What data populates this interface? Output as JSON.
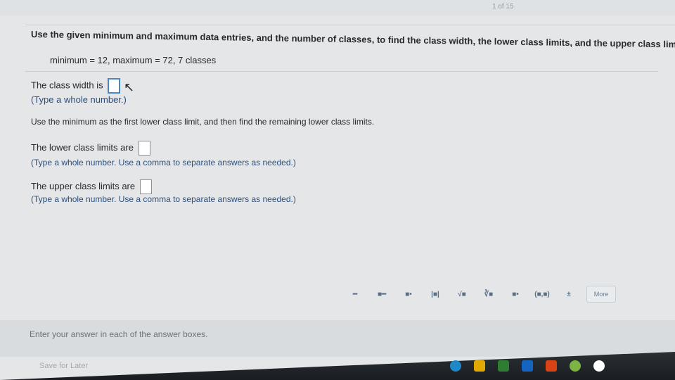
{
  "header": {
    "page_counter": "1 of 15"
  },
  "question": {
    "prompt": "Use the given minimum and maximum data entries, and the number of classes, to find the class width, the lower class limits, and the upper class limits.",
    "params": "minimum = 12,  maximum = 72,  7 classes"
  },
  "parts": {
    "class_width": {
      "label": "The class width is",
      "hint": "(Type a whole number.)"
    },
    "instruction": "Use the minimum as the first lower class limit, and then find the remaining lower class limits.",
    "lower_limits": {
      "label": "The lower class limits are",
      "hint": "(Type a whole number. Use a comma to separate answers as needed.)"
    },
    "upper_limits": {
      "label": "The upper class limits are",
      "hint": "(Type a whole number. Use a comma to separate answers as needed.)"
    }
  },
  "toolbar": {
    "buttons": [
      "fraction",
      "mixed-number",
      "exponent",
      "absolute-value",
      "square-root",
      "nth-root",
      "subscript",
      "interval",
      "plus-minus"
    ],
    "more_label": "More"
  },
  "footer": {
    "instruction": "Enter your answer in each of the answer boxes.",
    "save_label": "Save for Later"
  }
}
